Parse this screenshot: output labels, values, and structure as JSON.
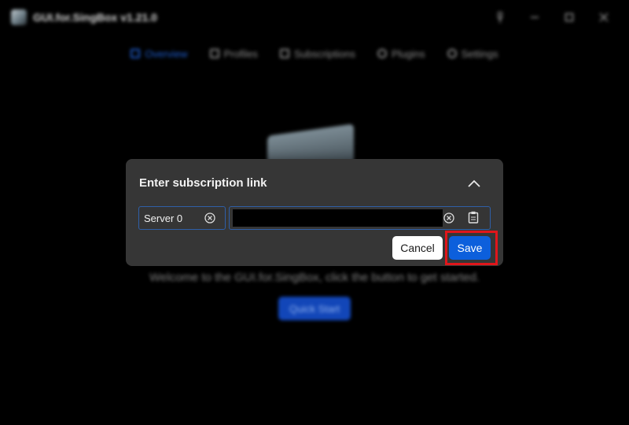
{
  "app": {
    "title": "GUI.for.SingBox v1.21.0",
    "window_controls": [
      "pin-icon",
      "minimize-icon",
      "maximize-icon",
      "close-icon"
    ]
  },
  "nav": {
    "items": [
      {
        "label": "Overview",
        "icon": "overview-icon",
        "active": true
      },
      {
        "label": "Profiles",
        "icon": "profiles-icon",
        "active": false
      },
      {
        "label": "Subscriptions",
        "icon": "subscriptions-icon",
        "active": false
      },
      {
        "label": "Plugins",
        "icon": "plugins-icon",
        "active": false
      },
      {
        "label": "Settings",
        "icon": "settings-icon",
        "active": false
      }
    ]
  },
  "main": {
    "welcome_text": "Welcome to the GUI.for.SingBox, click the button to get started.",
    "quick_start_label": "Quick Start"
  },
  "dialog": {
    "title": "Enter subscription link",
    "name_field": {
      "value": "Server 0"
    },
    "link_field": {
      "value": ""
    },
    "cancel_label": "Cancel",
    "save_label": "Save"
  },
  "colors": {
    "accent": "#0c5fdc",
    "highlight": "#e0161b",
    "dialog_bg": "#363636"
  }
}
